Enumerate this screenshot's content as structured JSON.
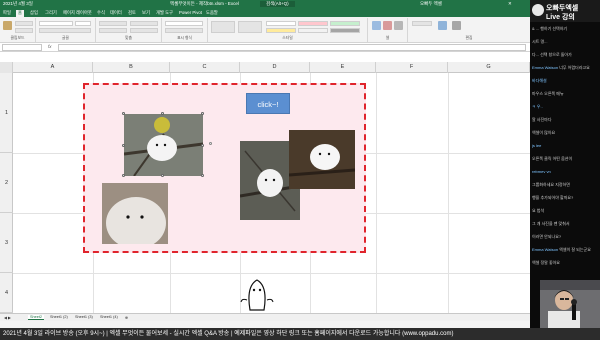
{
  "window": {
    "title_left": "2021년 4월 3일",
    "title": "엑셀무엇이든 - 제작btn.xlsm - Excel",
    "search_placeholder": "검색(Alt+Q)",
    "user": "오빠두 엑셀"
  },
  "ribbon": {
    "tabs": [
      "파일",
      "홈",
      "삽입",
      "그리기",
      "페이지 레이아웃",
      "수식",
      "데이터",
      "검토",
      "보기",
      "개발 도구",
      "Power Pivot",
      "도움말"
    ],
    "groups": [
      "클립보드",
      "글꼴",
      "맞춤",
      "표시 형식",
      "스타일",
      "셀",
      "편집"
    ]
  },
  "formula_bar": {
    "name_box": "",
    "fx": "fx",
    "value": ""
  },
  "grid": {
    "columns": [
      "A",
      "B",
      "C",
      "D",
      "E",
      "F",
      "G"
    ],
    "rows": [
      "1",
      "2",
      "3",
      "4"
    ]
  },
  "content": {
    "button_label": "click~!"
  },
  "sheet_tabs": [
    "Sheet2",
    "Sheet1 (2)",
    "Sheet1 (3)",
    "Sheet1 (4)"
  ],
  "banner": "2021년 4월 3일 라이브 방송 (오후 9시~) | 엑셀 무엇이든 물어보세 - 실시간 엑셀 Q&A 방송 | 예제파일은 영상 하단 링크 또는 홈페이지에서 다운로드 가능합니다 (www.oppadu.com)",
  "chat": {
    "title_line1": "오빠두엑셀",
    "title_line2": "Live 강의",
    "messages": [
      {
        "name": "",
        "text": "& ... 행하기 선택하기"
      },
      {
        "name": "",
        "text": "시트 명..."
      },
      {
        "name": "",
        "text": "다... 선택 창으로 돌아가"
      },
      {
        "name": "Emma Watson",
        "text": "너무 어렵더라고요"
      },
      {
        "name": "바다해설",
        "text": ""
      },
      {
        "name": "",
        "text": "마우스 오른쪽 메뉴"
      },
      {
        "name": "ㅋ 우..",
        "text": ""
      },
      {
        "name": "",
        "text": "알 사진마다"
      },
      {
        "name": "",
        "text": "엑셀이 많아요"
      },
      {
        "name": "js lee",
        "text": ""
      },
      {
        "name": "",
        "text": "오른쪽 클릭 어떤 옵션이"
      },
      {
        "name": "rebmev vn",
        "text": ""
      },
      {
        "name": "",
        "text": "그룹화하세요 지정하면"
      },
      {
        "name": "",
        "text": "행을 추가되어야 할까요?"
      },
      {
        "name": "",
        "text": "요 법석"
      },
      {
        "name": "",
        "text": "그 개 사진을 팬 맞춰서"
      },
      {
        "name": "",
        "text": "이러면 안되나요?"
      },
      {
        "name": "Emma Watson",
        "text": "엑셀이 잘 되는군요"
      },
      {
        "name": "",
        "text": "엑셀 정말 좋아요"
      }
    ]
  },
  "colors": {
    "excel_green": "#217346",
    "dashed_border": "#e0242c",
    "pink_fill": "#fde9ee",
    "button_blue": "#5b8fd1"
  }
}
